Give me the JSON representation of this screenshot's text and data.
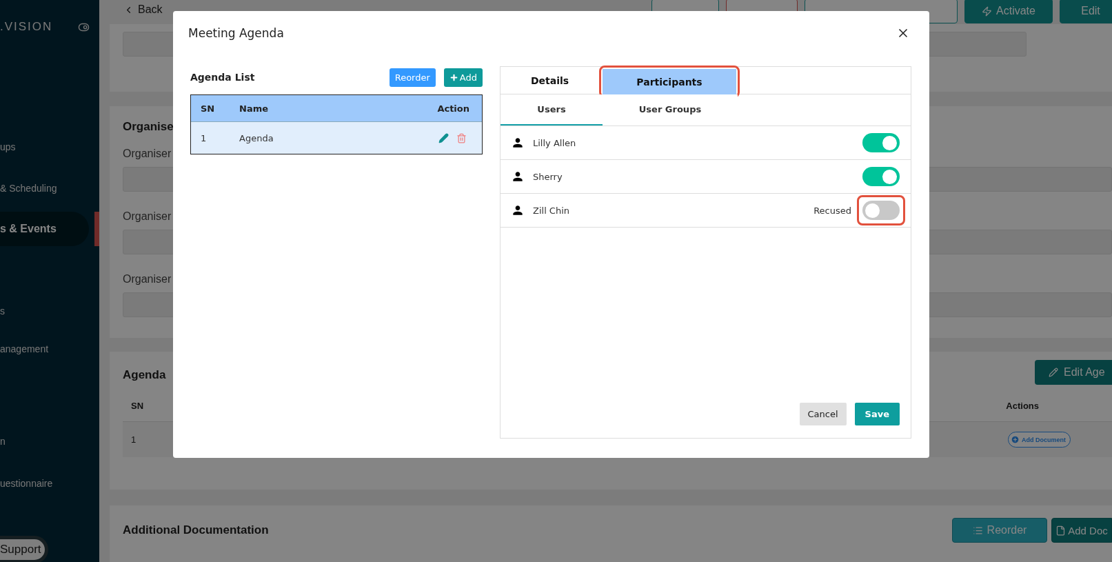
{
  "sidebar": {
    "brand": ".VISION",
    "items": [
      {
        "label": "ups",
        "selected": false
      },
      {
        "label": "& Scheduling",
        "selected": false
      },
      {
        "label": "s & Events",
        "selected": true
      },
      {
        "label": "s",
        "selected": false
      },
      {
        "label": "anagement",
        "selected": false
      },
      {
        "label": "n",
        "selected": false
      },
      {
        "label": "uestionnaire",
        "selected": false
      }
    ],
    "support_button": "Support"
  },
  "page": {
    "back_link": "Back",
    "actions": [
      {
        "kind": "outline"
      },
      {
        "kind": "danger"
      },
      {
        "kind": "notify"
      },
      {
        "label": "Activate",
        "kind": "activate"
      },
      {
        "label": "Edit",
        "kind": "solid"
      }
    ],
    "organiser_section": {
      "title": "Organise",
      "field_labels": [
        "Organiser",
        "Organiser",
        "Organiser"
      ]
    },
    "agenda_section": {
      "title": "Agenda",
      "edit_button": "Edit Age",
      "columns": [
        "SN",
        "Actions"
      ],
      "rows": [
        {
          "sn": "1",
          "action": "Add Document"
        }
      ]
    },
    "documentation_section": {
      "title": "Additional Documentation",
      "buttons": [
        {
          "label": "Reorder",
          "kind": "reorder"
        },
        {
          "label": "Add Doc",
          "kind": "add"
        }
      ]
    }
  },
  "dialog": {
    "title": "Meeting Agenda",
    "agenda_list": {
      "title": "Agenda List",
      "reorder_button": "Reorder",
      "add_button": "Add",
      "columns": [
        "SN",
        "Name",
        "Action"
      ],
      "rows": [
        {
          "sn": "1",
          "name": "Agenda",
          "selected": true
        }
      ]
    },
    "tabs": [
      {
        "label": "Details",
        "selected": false,
        "highlighted": false
      },
      {
        "label": "Participants",
        "selected": true,
        "highlighted": true
      }
    ],
    "subtabs": [
      {
        "label": "Users",
        "selected": true
      },
      {
        "label": "User Groups",
        "selected": false
      }
    ],
    "participants": [
      {
        "name": "Lilly Allen",
        "on": true,
        "highlighted": false
      },
      {
        "name": "Sherry",
        "on": true,
        "highlighted": false
      },
      {
        "name": "Zill Chin",
        "status": "Recused",
        "on": false,
        "highlighted": true
      }
    ],
    "cancel_button": "Cancel",
    "save_button": "Save"
  }
}
